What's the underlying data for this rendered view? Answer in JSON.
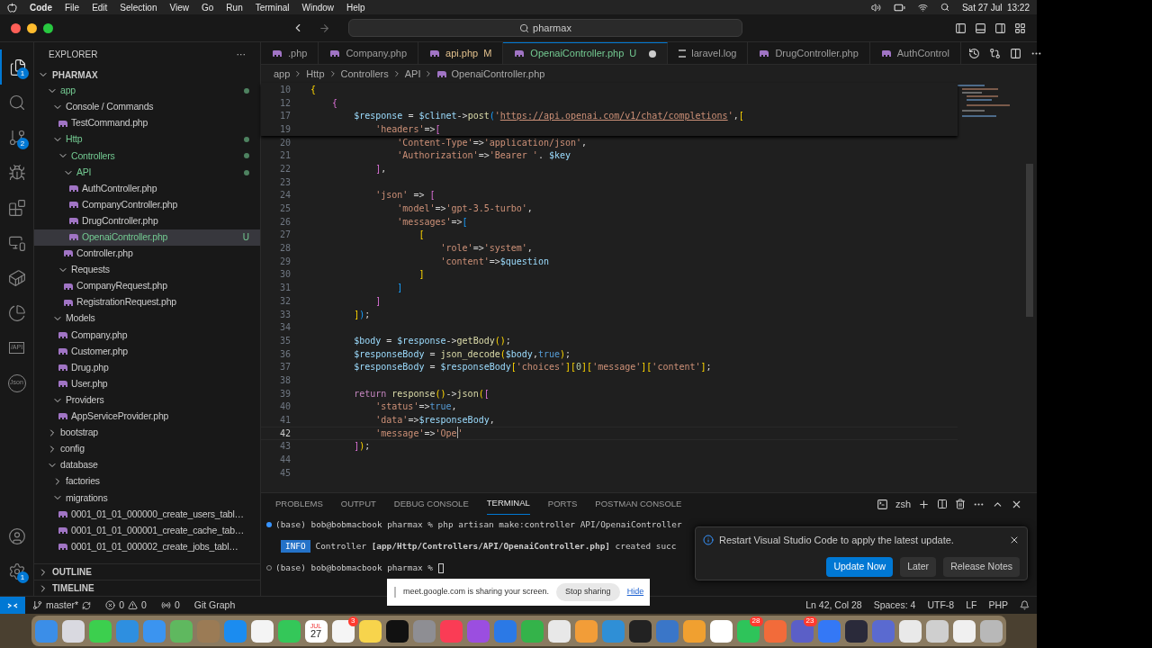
{
  "menu_bar": {
    "app": "Code",
    "items": [
      "File",
      "Edit",
      "Selection",
      "View",
      "Go",
      "Run",
      "Terminal",
      "Window",
      "Help"
    ],
    "clock": "Sat 27 Jul  13:22"
  },
  "title_bar": {
    "search": "pharmax"
  },
  "activity_bar": {
    "items": [
      {
        "kind": "explorer",
        "selected": true,
        "badge": "1"
      },
      {
        "kind": "search",
        "selected": false
      },
      {
        "kind": "source-control",
        "selected": false,
        "badge": "2"
      },
      {
        "kind": "debug",
        "selected": false
      },
      {
        "kind": "extensions",
        "selected": false
      },
      {
        "kind": "remote",
        "selected": false
      },
      {
        "kind": "docker",
        "selected": false
      },
      {
        "kind": "pie",
        "selected": false
      },
      {
        "kind": "api",
        "selected": false,
        "label": "/API"
      },
      {
        "kind": "json",
        "selected": false,
        "label": "Json"
      }
    ],
    "bottom": [
      {
        "kind": "account"
      },
      {
        "kind": "settings",
        "badge": "1"
      }
    ]
  },
  "sidebar": {
    "title": "EXPLORER",
    "more": "···",
    "root": "PHARMAX",
    "tree": [
      {
        "label": "app",
        "kind": "folder",
        "expanded": true,
        "changed": true,
        "selected": false,
        "children": [
          {
            "label": "Console / Commands",
            "kind": "folder",
            "expanded": true,
            "changed": false,
            "selected": false,
            "children": [
              {
                "label": "TestCommand.php",
                "kind": "file",
                "changed": false,
                "selected": false
              }
            ]
          },
          {
            "label": "Http",
            "kind": "folder",
            "expanded": true,
            "changed": true,
            "selected": false,
            "children": [
              {
                "label": "Controllers",
                "kind": "folder",
                "expanded": true,
                "changed": true,
                "selected": false,
                "children": [
                  {
                    "label": "API",
                    "kind": "folder",
                    "expanded": true,
                    "changed": true,
                    "selected": false,
                    "children": [
                      {
                        "label": "AuthController.php",
                        "kind": "file",
                        "changed": false,
                        "selected": false
                      },
                      {
                        "label": "CompanyController.php",
                        "kind": "file",
                        "changed": false,
                        "selected": false
                      },
                      {
                        "label": "DrugController.php",
                        "kind": "file",
                        "changed": false,
                        "selected": false
                      },
                      {
                        "label": "OpenaiController.php",
                        "kind": "file",
                        "changed": true,
                        "selected": true,
                        "badge": "U"
                      }
                    ]
                  },
                  {
                    "label": "Controller.php",
                    "kind": "file",
                    "changed": false,
                    "selected": false
                  }
                ]
              },
              {
                "label": "Requests",
                "kind": "folder",
                "expanded": true,
                "changed": false,
                "selected": false,
                "children": [
                  {
                    "label": "CompanyRequest.php",
                    "kind": "file",
                    "changed": false,
                    "selected": false
                  },
                  {
                    "label": "RegistrationRequest.php",
                    "kind": "file",
                    "changed": false,
                    "selected": false
                  }
                ]
              }
            ]
          },
          {
            "label": "Models",
            "kind": "folder",
            "expanded": true,
            "changed": false,
            "selected": false,
            "children": [
              {
                "label": "Company.php",
                "kind": "file",
                "changed": false,
                "selected": false
              },
              {
                "label": "Customer.php",
                "kind": "file",
                "changed": false,
                "selected": false
              },
              {
                "label": "Drug.php",
                "kind": "file",
                "changed": false,
                "selected": false
              },
              {
                "label": "User.php",
                "kind": "file",
                "changed": false,
                "selected": false
              }
            ]
          },
          {
            "label": "Providers",
            "kind": "folder",
            "expanded": true,
            "changed": false,
            "selected": false,
            "children": [
              {
                "label": "AppServiceProvider.php",
                "kind": "file",
                "changed": false,
                "selected": false
              }
            ]
          }
        ]
      },
      {
        "label": "bootstrap",
        "kind": "folder",
        "expanded": false,
        "changed": false,
        "selected": false
      },
      {
        "label": "config",
        "kind": "folder",
        "expanded": false,
        "changed": false,
        "selected": false
      },
      {
        "label": "database",
        "kind": "folder",
        "expanded": true,
        "changed": false,
        "selected": false,
        "children": [
          {
            "label": "factories",
            "kind": "folder",
            "expanded": false,
            "changed": false,
            "selected": false
          },
          {
            "label": "migrations",
            "kind": "folder",
            "expanded": true,
            "changed": false,
            "selected": false,
            "children": [
              {
                "label": "0001_01_01_000000_create_users_tabl…",
                "kind": "file",
                "changed": false,
                "selected": false
              },
              {
                "label": "0001_01_01_000001_create_cache_tab…",
                "kind": "file",
                "changed": false,
                "selected": false
              },
              {
                "label": "0001_01_01_000002_create_jobs_tabl…",
                "kind": "file",
                "changed": false,
                "selected": false
              }
            ]
          }
        ]
      }
    ],
    "sections": [
      {
        "label": "OUTLINE",
        "expanded": false
      },
      {
        "label": "TIMELINE",
        "expanded": false
      }
    ]
  },
  "tabs": [
    {
      "label": ".php",
      "kind": "php",
      "selected": false
    },
    {
      "label": "Company.php",
      "kind": "php",
      "selected": false
    },
    {
      "label": "api.php",
      "kind": "php",
      "selected": false,
      "status": "M"
    },
    {
      "label": "OpenaiController.php",
      "kind": "php",
      "selected": true,
      "status": "U",
      "dirty": true
    },
    {
      "label": "laravel.log",
      "kind": "log",
      "selected": false
    },
    {
      "label": "DrugController.php",
      "kind": "php",
      "selected": false
    },
    {
      "label": "AuthControl",
      "kind": "php",
      "selected": false
    }
  ],
  "breadcrumb": [
    "app",
    "Http",
    "Controllers",
    "API",
    "OpenaiController.php"
  ],
  "sticky_lines": [
    {
      "number": "10",
      "tokens": [
        {
          "text": "{",
          "kind": "b1"
        }
      ]
    },
    {
      "number": "12",
      "tokens": [
        {
          "text": "    {",
          "kind": "b2"
        }
      ]
    },
    {
      "number": "17",
      "tokens": [
        {
          "text": "        $response",
          "kind": "var"
        },
        {
          "text": " = ",
          "kind": "op"
        },
        {
          "text": "$clinet",
          "kind": "var"
        },
        {
          "text": "->",
          "kind": "op"
        },
        {
          "text": "post",
          "kind": "fn"
        },
        {
          "text": "(",
          "kind": "b3"
        },
        {
          "text": "'",
          "kind": "str"
        },
        {
          "text": "https://api.openai.com/v1/chat/completions",
          "kind": "url"
        },
        {
          "text": "'",
          "kind": "str"
        },
        {
          "text": ",",
          "kind": "op"
        },
        {
          "text": "[",
          "kind": "b1"
        }
      ]
    },
    {
      "number": "19",
      "tokens": [
        {
          "text": "            'headers'",
          "kind": "str"
        },
        {
          "text": "=>",
          "kind": "op"
        },
        {
          "text": "[",
          "kind": "b2"
        }
      ]
    }
  ],
  "lines": [
    {
      "number": "20",
      "current": false,
      "tokens": [
        {
          "text": "                'Content-Type'",
          "kind": "str"
        },
        {
          "text": "=>",
          "kind": "op"
        },
        {
          "text": "'application/json'",
          "kind": "str"
        },
        {
          "text": ",",
          "kind": "op"
        }
      ]
    },
    {
      "number": "21",
      "current": false,
      "tokens": [
        {
          "text": "                'Authorization'",
          "kind": "str"
        },
        {
          "text": "=>",
          "kind": "op"
        },
        {
          "text": "'Bearer '",
          "kind": "str"
        },
        {
          "text": ". ",
          "kind": "op"
        },
        {
          "text": "$key",
          "kind": "var"
        }
      ]
    },
    {
      "number": "22",
      "current": false,
      "tokens": [
        {
          "text": "            ]",
          "kind": "b2"
        },
        {
          "text": ",",
          "kind": "op"
        }
      ]
    },
    {
      "number": "23",
      "current": false
    },
    {
      "number": "24",
      "current": false,
      "tokens": [
        {
          "text": "            'json'",
          "kind": "str"
        },
        {
          "text": " => ",
          "kind": "op"
        },
        {
          "text": "[",
          "kind": "b2"
        }
      ]
    },
    {
      "number": "25",
      "current": false,
      "tokens": [
        {
          "text": "                'model'",
          "kind": "str"
        },
        {
          "text": "=>",
          "kind": "op"
        },
        {
          "text": "'gpt-3.5-turbo'",
          "kind": "str"
        },
        {
          "text": ",",
          "kind": "op"
        }
      ]
    },
    {
      "number": "26",
      "current": false,
      "tokens": [
        {
          "text": "                'messages'",
          "kind": "str"
        },
        {
          "text": "=>",
          "kind": "op"
        },
        {
          "text": "[",
          "kind": "b3"
        }
      ]
    },
    {
      "number": "27",
      "current": false,
      "tokens": [
        {
          "text": "                    [",
          "kind": "b1"
        }
      ]
    },
    {
      "number": "28",
      "current": false,
      "tokens": [
        {
          "text": "                        'role'",
          "kind": "str"
        },
        {
          "text": "=>",
          "kind": "op"
        },
        {
          "text": "'system'",
          "kind": "str"
        },
        {
          "text": ",",
          "kind": "op"
        }
      ]
    },
    {
      "number": "29",
      "current": false,
      "tokens": [
        {
          "text": "                        'content'",
          "kind": "str"
        },
        {
          "text": "=>",
          "kind": "op"
        },
        {
          "text": "$question",
          "kind": "var"
        }
      ]
    },
    {
      "number": "30",
      "current": false,
      "tokens": [
        {
          "text": "                    ]",
          "kind": "b1"
        }
      ]
    },
    {
      "number": "31",
      "current": false,
      "tokens": [
        {
          "text": "                ]",
          "kind": "b3"
        }
      ]
    },
    {
      "number": "32",
      "current": false,
      "tokens": [
        {
          "text": "            ]",
          "kind": "b2"
        }
      ]
    },
    {
      "number": "33",
      "current": false,
      "tokens": [
        {
          "text": "        ]",
          "kind": "b1"
        },
        {
          "text": ")",
          "kind": "b3"
        },
        {
          "text": ";",
          "kind": "op"
        }
      ]
    },
    {
      "number": "34",
      "current": false
    },
    {
      "number": "35",
      "current": false,
      "tokens": [
        {
          "text": "        $body",
          "kind": "var"
        },
        {
          "text": " = ",
          "kind": "op"
        },
        {
          "text": "$response",
          "kind": "var"
        },
        {
          "text": "->",
          "kind": "op"
        },
        {
          "text": "getBody",
          "kind": "fn"
        },
        {
          "text": "()",
          "kind": "b1"
        },
        {
          "text": ";",
          "kind": "op"
        }
      ]
    },
    {
      "number": "36",
      "current": false,
      "tokens": [
        {
          "text": "        $responseBody",
          "kind": "var"
        },
        {
          "text": " = ",
          "kind": "op"
        },
        {
          "text": "json_decode",
          "kind": "fn"
        },
        {
          "text": "(",
          "kind": "b1"
        },
        {
          "text": "$body",
          "kind": "var"
        },
        {
          "text": ",",
          "kind": "op"
        },
        {
          "text": "true",
          "kind": "bool"
        },
        {
          "text": ")",
          "kind": "b1"
        },
        {
          "text": ";",
          "kind": "op"
        }
      ]
    },
    {
      "number": "37",
      "current": false,
      "tokens": [
        {
          "text": "        $responseBody",
          "kind": "var"
        },
        {
          "text": " = ",
          "kind": "op"
        },
        {
          "text": "$responseBody",
          "kind": "var"
        },
        {
          "text": "[",
          "kind": "b1"
        },
        {
          "text": "'choices'",
          "kind": "str"
        },
        {
          "text": "][",
          "kind": "b1"
        },
        {
          "text": "0",
          "kind": "num"
        },
        {
          "text": "][",
          "kind": "b1"
        },
        {
          "text": "'message'",
          "kind": "str"
        },
        {
          "text": "][",
          "kind": "b1"
        },
        {
          "text": "'content'",
          "kind": "str"
        },
        {
          "text": "]",
          "kind": "b1"
        },
        {
          "text": ";",
          "kind": "op"
        }
      ]
    },
    {
      "number": "38",
      "current": false
    },
    {
      "number": "39",
      "current": false,
      "tokens": [
        {
          "text": "        return",
          "kind": "kw"
        },
        {
          "text": " response",
          "kind": "fn"
        },
        {
          "text": "()",
          "kind": "b1"
        },
        {
          "text": "->",
          "kind": "op"
        },
        {
          "text": "json",
          "kind": "fn"
        },
        {
          "text": "(",
          "kind": "b1"
        },
        {
          "text": "[",
          "kind": "b2"
        }
      ]
    },
    {
      "number": "40",
      "current": false,
      "tokens": [
        {
          "text": "            'status'",
          "kind": "str"
        },
        {
          "text": "=>",
          "kind": "op"
        },
        {
          "text": "true",
          "kind": "bool"
        },
        {
          "text": ",",
          "kind": "op"
        }
      ]
    },
    {
      "number": "41",
      "current": false,
      "tokens": [
        {
          "text": "            'data'",
          "kind": "str"
        },
        {
          "text": "=>",
          "kind": "op"
        },
        {
          "text": "$responseBody",
          "kind": "var"
        },
        {
          "text": ",",
          "kind": "op"
        }
      ]
    },
    {
      "number": "42",
      "current": true,
      "tokens": [
        {
          "text": "            'message'",
          "kind": "str"
        },
        {
          "text": "=>",
          "kind": "op"
        },
        {
          "text": "'Ope",
          "kind": "str",
          "caret": true
        },
        {
          "text": "'",
          "kind": "str"
        }
      ]
    },
    {
      "number": "43",
      "current": false,
      "tokens": [
        {
          "text": "        ]",
          "kind": "b2"
        },
        {
          "text": ")",
          "kind": "b1"
        },
        {
          "text": ";",
          "kind": "op"
        }
      ]
    },
    {
      "number": "44",
      "current": false
    },
    {
      "number": "45",
      "current": false
    }
  ],
  "panel": {
    "tabs": [
      {
        "label": "PROBLEMS",
        "selected": false
      },
      {
        "label": "OUTPUT",
        "selected": false
      },
      {
        "label": "DEBUG CONSOLE",
        "selected": false
      },
      {
        "label": "TERMINAL",
        "selected": true
      },
      {
        "label": "PORTS",
        "selected": false
      },
      {
        "label": "POSTMAN CONSOLE",
        "selected": false
      }
    ],
    "shell": "zsh",
    "terminal": [
      {
        "kind": "command",
        "done": true,
        "text": "(base) bob@bobmacbook pharmax % php artisan make:controller API/OpenaiController"
      },
      {
        "kind": "info",
        "tag": "INFO",
        "text": "Controller ",
        "path": "[app/Http/Controllers/API/OpenaiController.php]",
        "rest": " created succ"
      },
      {
        "kind": "command",
        "done": false,
        "text": "(base) bob@bobmacbook pharmax % "
      }
    ]
  },
  "notification": {
    "message": "Restart Visual Studio Code to apply the latest update.",
    "buttons": [
      {
        "label": "Update Now",
        "primary": true
      },
      {
        "label": "Later",
        "primary": false
      },
      {
        "label": "Release Notes",
        "primary": false
      }
    ]
  },
  "share_bar": {
    "message": "meet.google.com is sharing your screen.",
    "stop": "Stop sharing",
    "hide": "Hide"
  },
  "status_bar": {
    "branch": "master*",
    "errors": "0",
    "warnings": "0",
    "ports": "0",
    "git_graph": "Git Graph",
    "right": [
      "Ln 42, Col 28",
      "Spaces: 4",
      "UTF-8",
      "LF",
      "PHP"
    ]
  },
  "dock": [
    {
      "color": "#3b8ee8"
    },
    {
      "color": "#d9d9e0"
    },
    {
      "color": "#3ccf4e"
    },
    {
      "color": "#2e8fe0"
    },
    {
      "color": "#3b94f0"
    },
    {
      "color": "#5fb85f"
    },
    {
      "color": "#9b7b55"
    },
    {
      "color": "#1b8cf0"
    },
    {
      "color": "#f4f4f4"
    },
    {
      "color": "#34c759"
    },
    {
      "color": "#ffffff",
      "month": "JUL",
      "day": "27"
    },
    {
      "color": "#f5f5f5",
      "badge": "3"
    },
    {
      "color": "#f7d44c"
    },
    {
      "color": "#111111"
    },
    {
      "color": "#8e8e93"
    },
    {
      "color": "#fa3c55"
    },
    {
      "color": "#9b4ee0"
    },
    {
      "color": "#2b79e6"
    },
    {
      "color": "#34b34a"
    },
    {
      "color": "#e8e8e8"
    },
    {
      "color": "#f29d38"
    },
    {
      "color": "#2f8fd6"
    },
    {
      "color": "#222222"
    },
    {
      "color": "#3a76c8"
    },
    {
      "color": "#f0a030"
    },
    {
      "color": "#ffffff"
    },
    {
      "color": "#2ec45a",
      "badge": "28"
    },
    {
      "color": "#f26b3a"
    },
    {
      "color": "#5b5fc7",
      "badge": "23"
    },
    {
      "color": "#3478f6"
    },
    {
      "color": "#2a2a3a"
    },
    {
      "color": "#5a6ad0"
    },
    {
      "color": "#e9e9e9"
    },
    {
      "color": "#cfcfcf"
    },
    {
      "color": "#f0f0f0"
    },
    {
      "color": "#b8b8b8"
    }
  ]
}
